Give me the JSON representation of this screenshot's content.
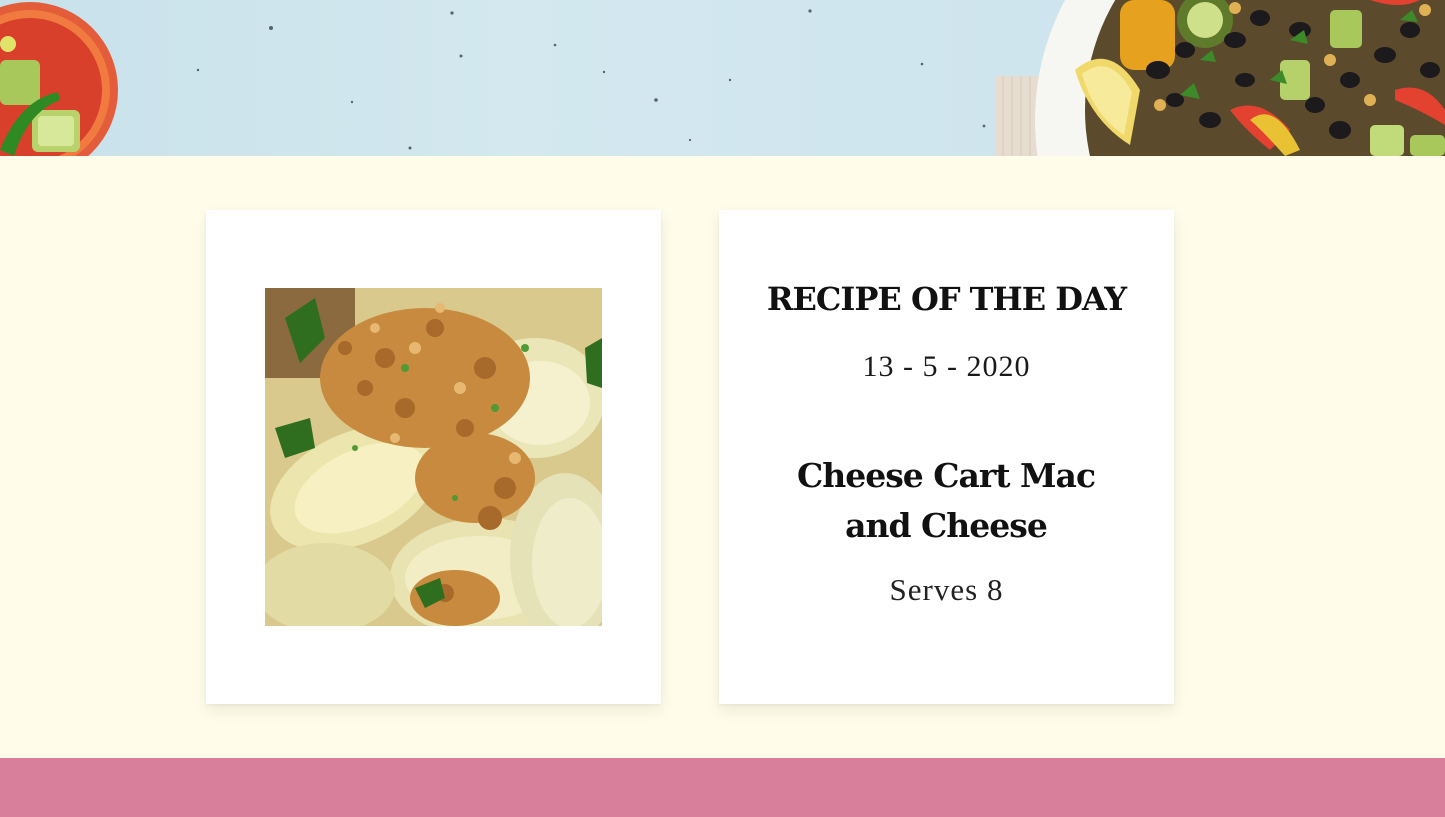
{
  "colors": {
    "page_background": "#fffdea",
    "card_background": "#ffffff",
    "footer_band": "#d8809b",
    "hero_sky": "#cfe5ee",
    "text": "#111111"
  },
  "hero": {
    "image": "food-banner-image"
  },
  "recipe_photo": {
    "image": "pasta-dish-image"
  },
  "recipe_of_the_day": {
    "heading": "RECIPE OF THE DAY",
    "date": "13 - 5 - 2020",
    "title": "Cheese Cart Mac and Cheese",
    "serves": "Serves 8"
  }
}
